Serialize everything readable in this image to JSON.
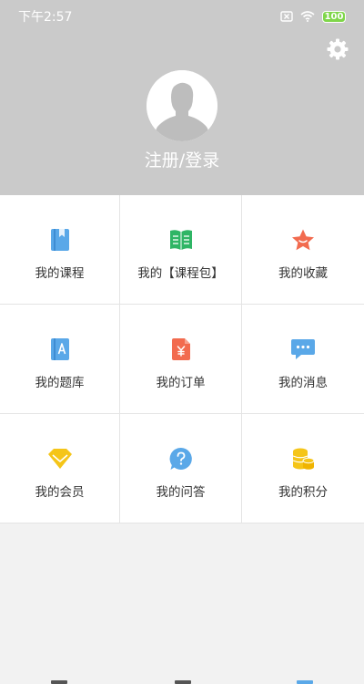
{
  "status_bar": {
    "time": "下午2:57",
    "battery": "100",
    "icons": [
      "sim-off-icon",
      "wifi-icon",
      "battery-icon"
    ]
  },
  "header": {
    "settings_icon": "gear-icon",
    "avatar_icon": "default-avatar-icon",
    "login_label": "注册/登录"
  },
  "menu": {
    "items": [
      {
        "label": "我的课程",
        "icon": "book-icon",
        "color": "#5aa8e8"
      },
      {
        "label": "我的【课程包】",
        "icon": "open-book-icon",
        "color": "#2fb565"
      },
      {
        "label": "我的收藏",
        "icon": "star-icon",
        "color": "#f26b4f"
      },
      {
        "label": "我的题库",
        "icon": "question-bank-icon",
        "color": "#5aa8e8"
      },
      {
        "label": "我的订单",
        "icon": "order-icon",
        "color": "#f26b4f"
      },
      {
        "label": "我的消息",
        "icon": "chat-bubble-icon",
        "color": "#5aa8e8"
      },
      {
        "label": "我的会员",
        "icon": "vip-diamond-icon",
        "color": "#f5c518"
      },
      {
        "label": "我的问答",
        "icon": "question-bubble-icon",
        "color": "#5aa8e8"
      },
      {
        "label": "我的积分",
        "icon": "coins-icon",
        "color": "#f5c518"
      }
    ]
  }
}
